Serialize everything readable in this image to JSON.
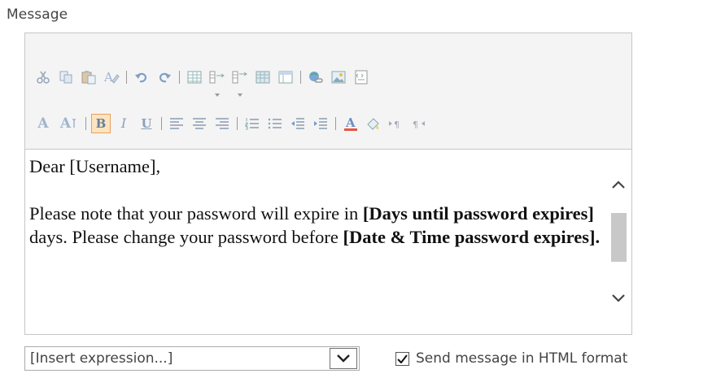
{
  "label": "Message",
  "toolbar": {
    "row1": [
      "cut-icon",
      "copy-icon",
      "paste-icon",
      "clear-format-icon",
      "undo-icon",
      "redo-icon",
      "table-icon",
      "insert-row-icon",
      "insert-column-icon",
      "grid-icon",
      "panel-icon",
      "link-icon",
      "image-icon",
      "source-icon"
    ],
    "row2": [
      "font-size-up-icon",
      "font-size-down-icon",
      "bold-button",
      "italic-button",
      "underline-button",
      "align-left-icon",
      "align-center-icon",
      "align-right-icon",
      "numbered-list-icon",
      "bullet-list-icon",
      "outdent-icon",
      "indent-icon",
      "font-color-icon",
      "highlight-icon",
      "ltr-icon",
      "rtl-icon"
    ],
    "font_size_up": "A",
    "font_size_down": "A",
    "bold": "B",
    "italic": "I",
    "underline": "U"
  },
  "body": {
    "greeting": "Dear [Username],",
    "p1_start": "Please note that your password will expire in ",
    "p1_bold1": "[Days until password expires]",
    "p1_mid": " days. Please change your password before ",
    "p1_bold2": "[Date & Time password expires]."
  },
  "insert_expression": {
    "value": "[Insert expression...]"
  },
  "html_format": {
    "label": "Send message in HTML format",
    "checked": true
  },
  "colors": {
    "toolbar_bg": "#f4f4f4",
    "active_bg": "#fce4c0",
    "active_border": "#e9a15a",
    "font_color_bar": "#e8553c"
  }
}
